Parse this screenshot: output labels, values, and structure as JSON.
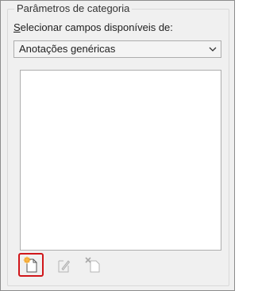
{
  "panel": {
    "group_title": "Parâmetros de categoria",
    "select_label_hotkey": "S",
    "select_label_rest": "elecionar campos disponíveis de:",
    "dropdown": {
      "selected": "Anotações genéricas"
    },
    "list_items": [],
    "toolbar": [
      {
        "name": "new-parameter-button",
        "icon": "new-document-star-icon",
        "enabled": true,
        "highlighted": true
      },
      {
        "name": "edit-parameter-button",
        "icon": "pencil-document-icon",
        "enabled": false
      },
      {
        "name": "delete-parameter-button",
        "icon": "delete-document-icon",
        "enabled": false
      }
    ]
  },
  "colors": {
    "highlight": "#d0161a",
    "accent": "#f29c1f"
  }
}
